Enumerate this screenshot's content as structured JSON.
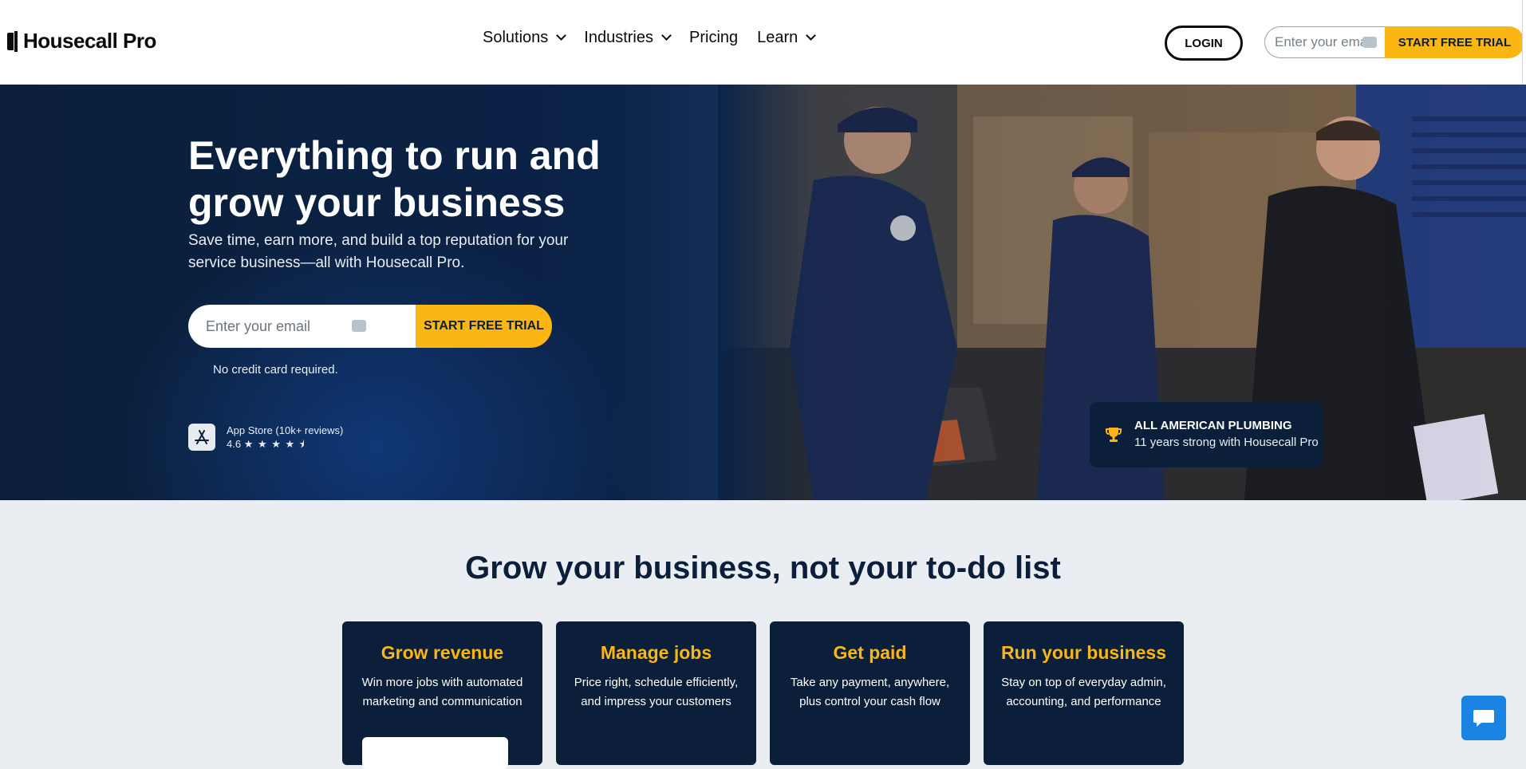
{
  "header": {
    "logo_text": "Housecall Pro",
    "nav": [
      {
        "label": "Solutions",
        "has_dropdown": true
      },
      {
        "label": "Industries",
        "has_dropdown": true
      },
      {
        "label": "Pricing",
        "has_dropdown": false
      },
      {
        "label": "Learn",
        "has_dropdown": true
      }
    ],
    "login_label": "LOGIN",
    "email_placeholder": "Enter your email",
    "cta_label": "START FREE TRIAL"
  },
  "hero": {
    "title": "Everything to run and grow your business",
    "subtitle": "Save time, earn more, and build a top reputation for your service business—all with Housecall Pro.",
    "email_placeholder": "Enter your email",
    "cta_label": "START FREE TRIAL",
    "note": "No credit card required.",
    "app_store": {
      "label": "App Store (10k+ reviews)",
      "rating": "4.6",
      "stars": "★ ★ ★ ★ ⯨"
    },
    "testimonial_badge": {
      "title": "ALL AMERICAN PLUMBING",
      "subtitle": "11 years strong with Housecall Pro"
    }
  },
  "features": {
    "title": "Grow your business, not your to-do list",
    "cards": [
      {
        "title": "Grow revenue",
        "desc": "Win more jobs with automated marketing and communication"
      },
      {
        "title": "Manage jobs",
        "desc": "Price right, schedule efficiently, and impress your customers"
      },
      {
        "title": "Get paid",
        "desc": "Take any payment, anywhere, plus control your cash flow"
      },
      {
        "title": "Run your business",
        "desc": "Stay on top of everyday admin, accounting, and performance"
      }
    ]
  },
  "colors": {
    "navy": "#0b1f3a",
    "accent_yellow": "#fbb614",
    "chat_blue": "#1a84e3",
    "section_bg": "#eaedf1"
  }
}
